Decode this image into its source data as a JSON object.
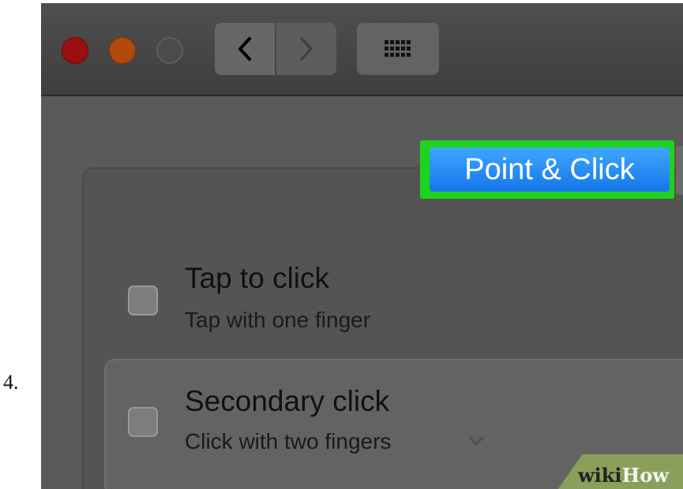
{
  "step_number": "4.",
  "toolbar": {
    "traffic_lights": {
      "close": "#9a0f0f",
      "minimize": "#b24a0c",
      "zoom": "#4b4b4b"
    },
    "back_icon": "chevron-left",
    "forward_icon": "chevron-right",
    "show_all_icon": "grid-dots"
  },
  "tabs": {
    "active_label": "Point & Click",
    "highlight_color": "#1ed31e"
  },
  "options": [
    {
      "title": "Tap to click",
      "description": "Tap with one finger",
      "checked": false
    },
    {
      "title": "Secondary click",
      "description": "Click with two fingers",
      "checked": false
    }
  ],
  "watermark": {
    "wiki": "wiki",
    "how": "How"
  }
}
